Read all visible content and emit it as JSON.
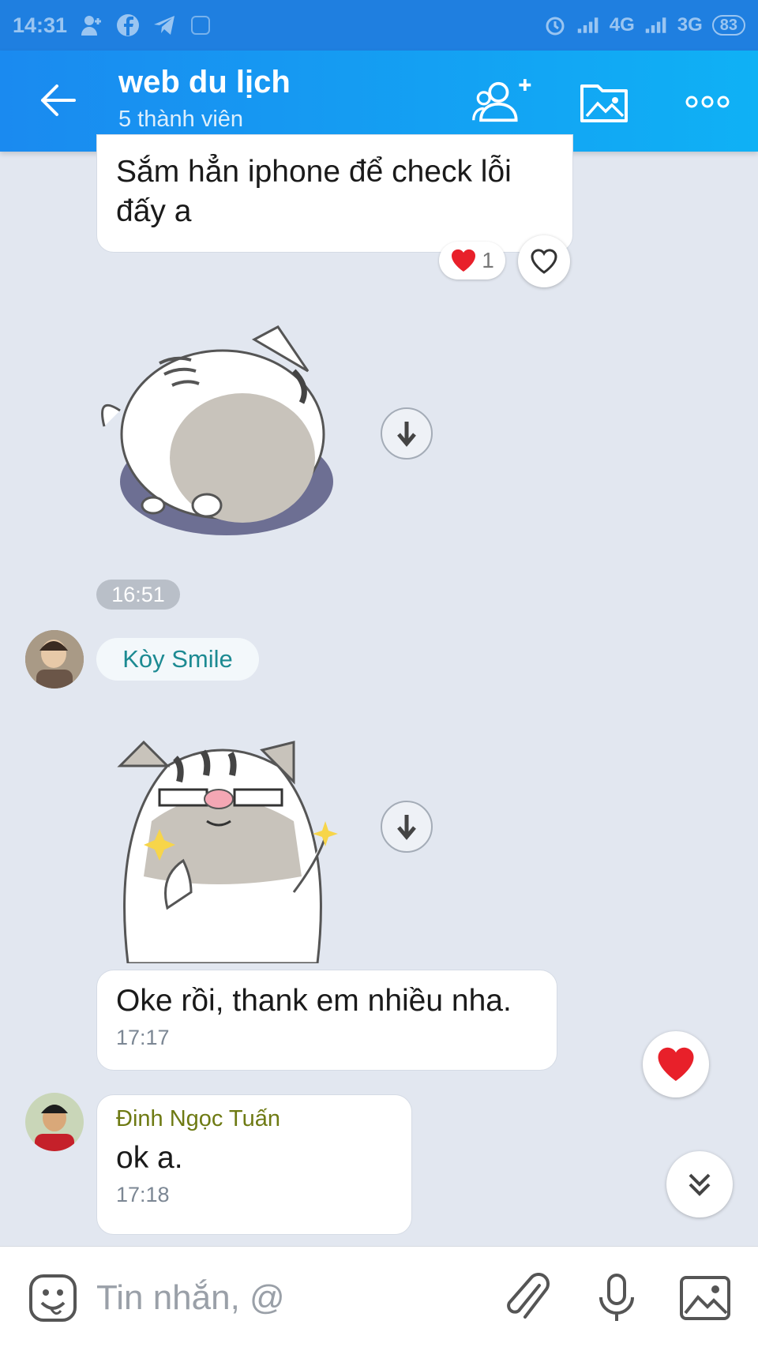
{
  "status_bar": {
    "time": "14:31",
    "network_1": "4G",
    "network_2": "3G",
    "battery": "83"
  },
  "header": {
    "title": "web du lịch",
    "subtitle": "5 thành viên"
  },
  "messages": {
    "m1_text": "Sắm hẳn iphone để check lỗi đấy a",
    "m1_reaction_count": "1",
    "divider_time": "16:51",
    "sender_koy": "Kòy Smile",
    "m2_text": "Oke rồi, thank em nhiều nha.",
    "m2_time": "17:17",
    "sender_dinh": "Đinh Ngọc Tuấn",
    "m3_text": "ok a.",
    "m3_time": "17:18"
  },
  "input": {
    "placeholder": "Tin nhắn, @"
  },
  "colors": {
    "header_start": "#1a8af0",
    "header_end": "#0fb1f5",
    "chat_bg": "#e2e7f0",
    "sender_koy": "#1c8a92",
    "sender_dinh": "#6e7a13",
    "heart": "#e8202a"
  },
  "icons": [
    "back-arrow-icon",
    "add-member-icon",
    "media-folder-icon",
    "more-icon",
    "heart-icon",
    "download-icon",
    "scroll-down-icon",
    "sticker-icon",
    "attach-icon",
    "mic-icon",
    "image-icon"
  ]
}
